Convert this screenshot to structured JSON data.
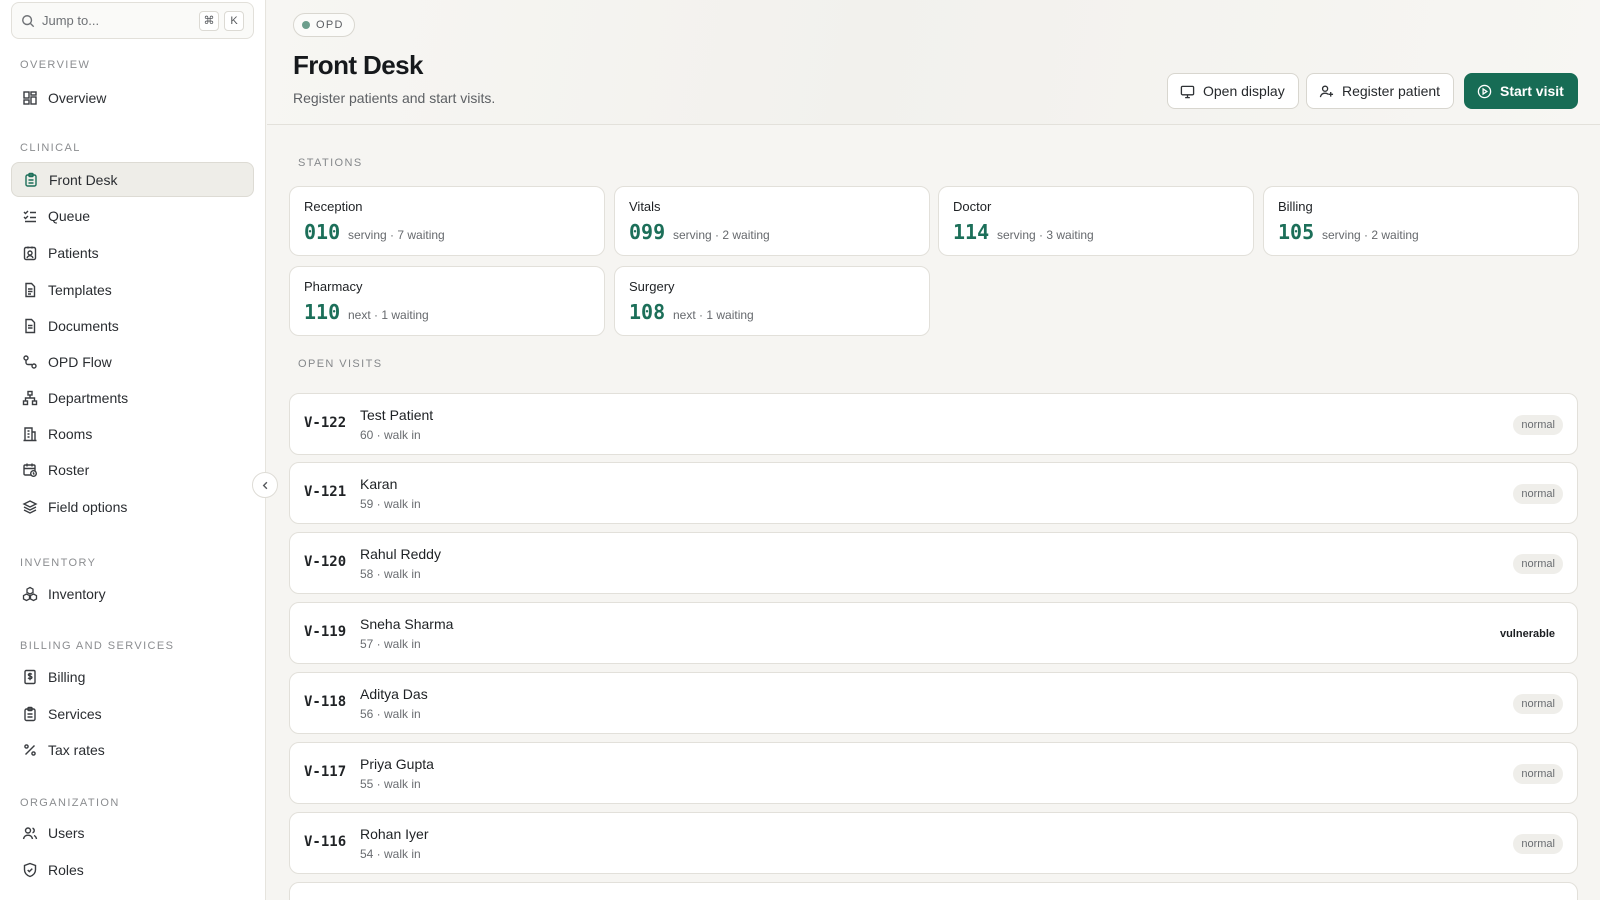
{
  "search": {
    "placeholder": "Jump to...",
    "kbd1": "⌘",
    "kbd2": "K"
  },
  "sidebar": {
    "sections": [
      {
        "label": "OVERVIEW"
      },
      {
        "label": "CLINICAL"
      },
      {
        "label": "INVENTORY"
      },
      {
        "label": "BILLING AND SERVICES"
      },
      {
        "label": "ORGANIZATION"
      }
    ],
    "items": [
      {
        "label": "Overview",
        "icon": "grid-icon"
      },
      {
        "label": "Front Desk",
        "icon": "clipboard-icon",
        "active": true
      },
      {
        "label": "Queue",
        "icon": "list-check-icon"
      },
      {
        "label": "Patients",
        "icon": "id-card-icon"
      },
      {
        "label": "Templates",
        "icon": "file-text-icon"
      },
      {
        "label": "Documents",
        "icon": "file-icon"
      },
      {
        "label": "OPD Flow",
        "icon": "route-icon"
      },
      {
        "label": "Departments",
        "icon": "network-icon"
      },
      {
        "label": "Rooms",
        "icon": "building-icon"
      },
      {
        "label": "Roster",
        "icon": "calendar-clock-icon"
      },
      {
        "label": "Field options",
        "icon": "layers-icon"
      },
      {
        "label": "Inventory",
        "icon": "boxes-icon"
      },
      {
        "label": "Billing",
        "icon": "dollar-file-icon"
      },
      {
        "label": "Services",
        "icon": "clipboard-list-icon"
      },
      {
        "label": "Tax rates",
        "icon": "percent-icon"
      },
      {
        "label": "Users",
        "icon": "users-icon"
      },
      {
        "label": "Roles",
        "icon": "shield-icon"
      }
    ]
  },
  "header": {
    "badge": "OPD",
    "title": "Front Desk",
    "subtitle": "Register patients and start visits.",
    "buttons": {
      "open_display": "Open display",
      "register_patient": "Register patient",
      "start_visit": "Start visit"
    }
  },
  "stations": {
    "label": "STATIONS",
    "items": [
      {
        "name": "Reception",
        "number": "010",
        "meta": "serving · 7 waiting"
      },
      {
        "name": "Vitals",
        "number": "099",
        "meta": "serving · 2 waiting"
      },
      {
        "name": "Doctor",
        "number": "114",
        "meta": "serving · 3 waiting"
      },
      {
        "name": "Billing",
        "number": "105",
        "meta": "serving · 2 waiting"
      },
      {
        "name": "Pharmacy",
        "number": "110",
        "meta": "next · 1 waiting"
      },
      {
        "name": "Surgery",
        "number": "108",
        "meta": "next · 1 waiting"
      }
    ]
  },
  "visits": {
    "label": "OPEN VISITS",
    "items": [
      {
        "id": "V-122",
        "name": "Test Patient",
        "meta": "60 · walk in",
        "tag": "normal"
      },
      {
        "id": "V-121",
        "name": "Karan",
        "meta": "59 · walk in",
        "tag": "normal"
      },
      {
        "id": "V-120",
        "name": "Rahul Reddy",
        "meta": "58 · walk in",
        "tag": "normal"
      },
      {
        "id": "V-119",
        "name": "Sneha Sharma",
        "meta": "57 · walk in",
        "tag": "vulnerable"
      },
      {
        "id": "V-118",
        "name": "Aditya Das",
        "meta": "56 · walk in",
        "tag": "normal"
      },
      {
        "id": "V-117",
        "name": "Priya Gupta",
        "meta": "55 · walk in",
        "tag": "normal"
      },
      {
        "id": "V-116",
        "name": "Rohan Iyer",
        "meta": "54 · walk in",
        "tag": "normal"
      }
    ]
  },
  "colors": {
    "accent": "#176c55",
    "accent_text": "#1c6f59"
  }
}
